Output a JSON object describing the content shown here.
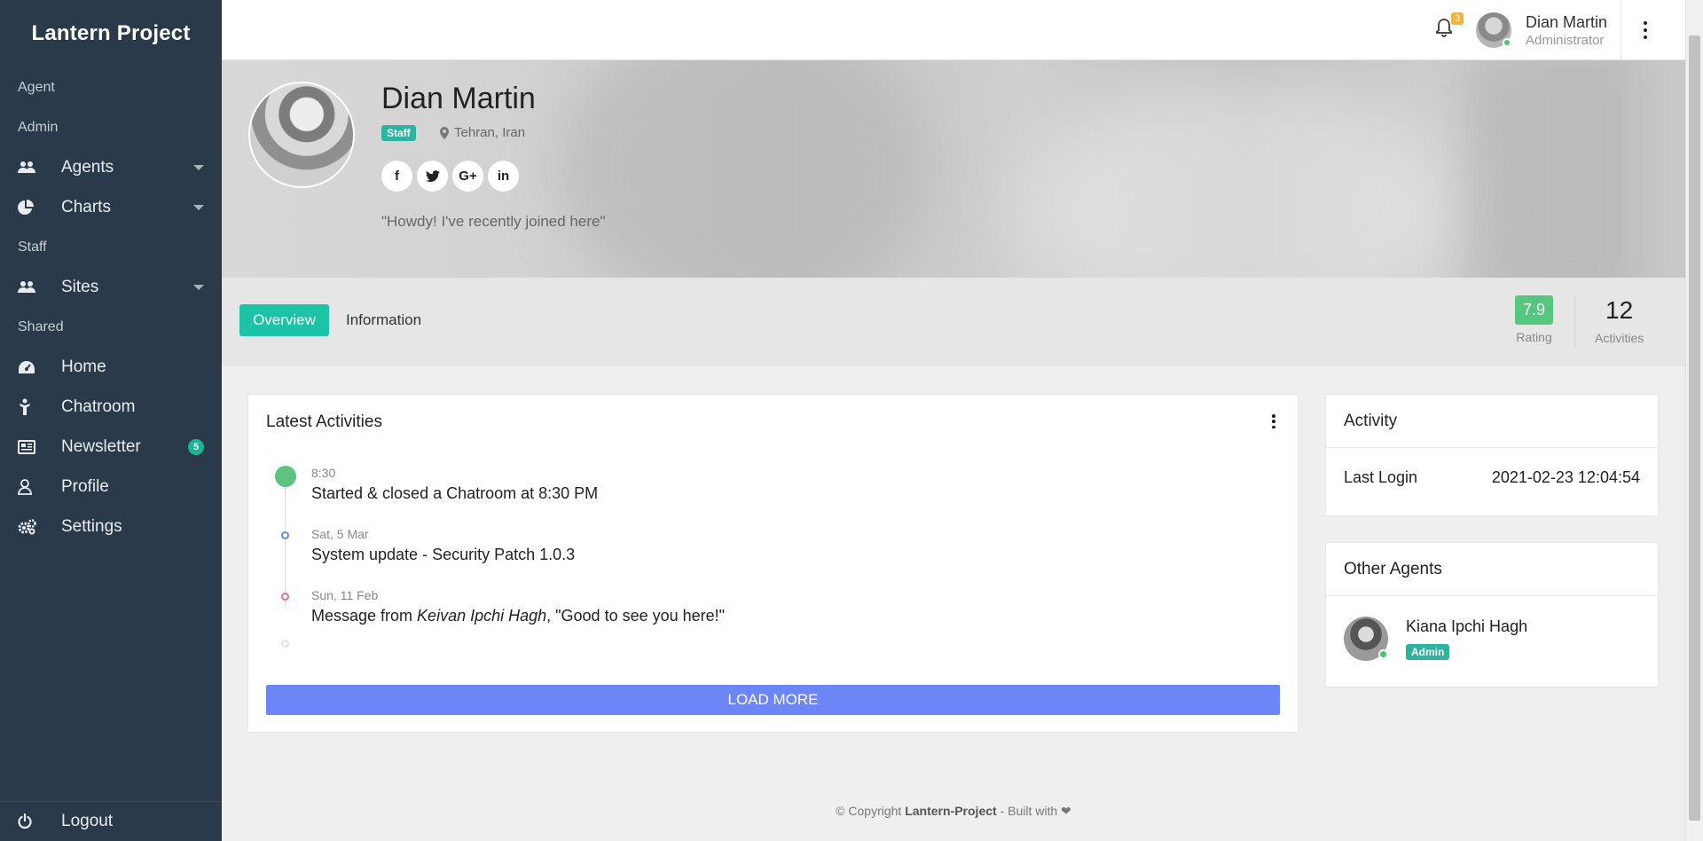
{
  "app": {
    "title": "Lantern Project"
  },
  "sidebar": {
    "sections": {
      "agent": "Agent",
      "admin": "Admin",
      "staff": "Staff",
      "shared": "Shared"
    },
    "items": {
      "agents": "Agents",
      "charts": "Charts",
      "sites": "Sites",
      "home": "Home",
      "chatroom": "Chatroom",
      "newsletter": "Newsletter",
      "newsletter_badge": "5",
      "profile": "Profile",
      "settings": "Settings",
      "logout": "Logout"
    }
  },
  "topbar": {
    "notification_count": "3",
    "user_name": "Dian Martin",
    "user_role": "Administrator"
  },
  "profile": {
    "name": "Dian Martin",
    "badge": "Staff",
    "location": "Tehran, Iran",
    "socials": [
      "f",
      "t",
      "G+",
      "in"
    ],
    "quote": "\"Howdy! I've recently joined here\""
  },
  "tabs": {
    "overview": "Overview",
    "information": "Information"
  },
  "stats": {
    "rating_value": "7.9",
    "rating_label": "Rating",
    "activities_value": "12",
    "activities_label": "Activities"
  },
  "latest": {
    "title": "Latest Activities",
    "items": [
      {
        "time": "8:30",
        "text": "Started & closed a Chatroom at 8:30 PM",
        "color": "#5cc47f"
      },
      {
        "time": "Sat, 5 Mar",
        "text": "System update - Security Patch 1.0.3",
        "color": "#6d86f7"
      },
      {
        "time": "Sun, 11 Feb",
        "text_prefix": "Message from ",
        "text_em": "Keivan Ipchi Hagh",
        "text_suffix": ", \"Good to see you here!\"",
        "color": "#f06a8a"
      }
    ],
    "load_more": "LOAD MORE"
  },
  "activity": {
    "title": "Activity",
    "last_login_label": "Last Login",
    "last_login_value": "2021-02-23 12:04:54"
  },
  "agents": {
    "title": "Other Agents",
    "name": "Kiana Ipchi Hagh",
    "badge": "Admin"
  },
  "footer": {
    "prefix": "© Copyright ",
    "brand": "Lantern-Project",
    "suffix": " - Built with ❤"
  },
  "colors": {
    "sidebar": "#2b3a4a",
    "accent": "#1cc3a6",
    "primary": "#6d86f7",
    "rating": "#55c77e",
    "warning": "#f2b33d"
  }
}
